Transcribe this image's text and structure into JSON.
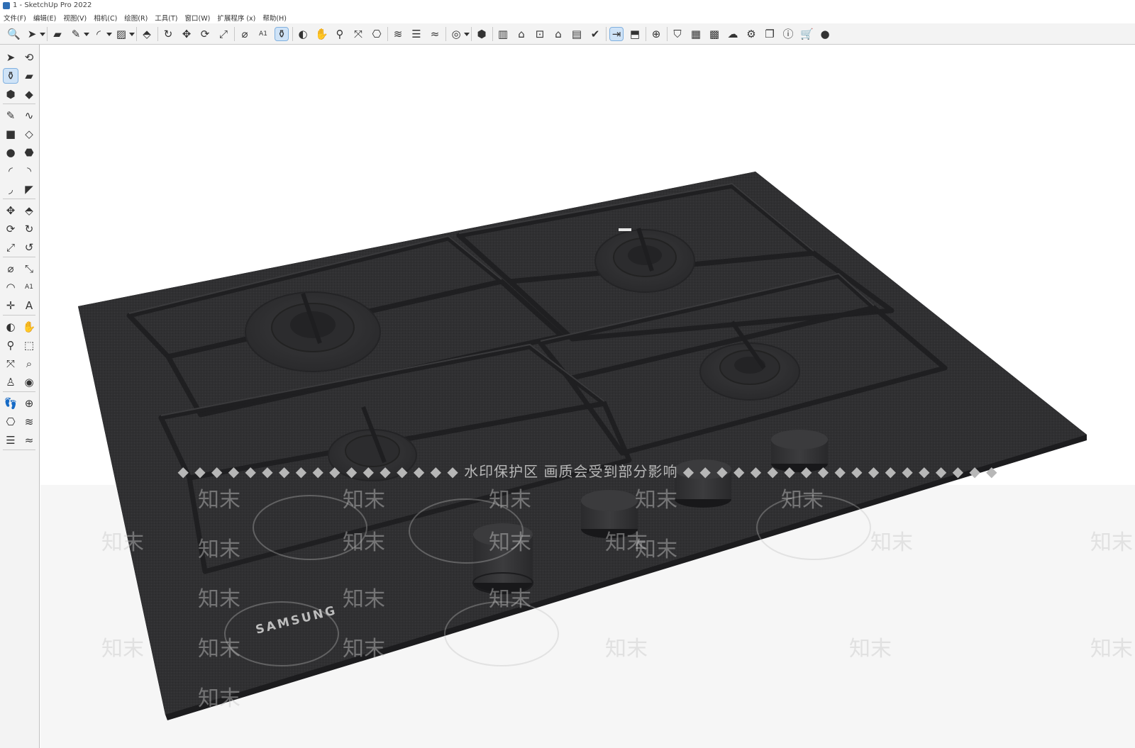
{
  "window": {
    "title": "1 - SketchUp Pro 2022"
  },
  "menu": [
    "文件(F)",
    "编辑(E)",
    "视图(V)",
    "相机(C)",
    "绘图(R)",
    "工具(T)",
    "窗口(W)",
    "扩展程序 (x)",
    "帮助(H)"
  ],
  "toolbar_icons": [
    {
      "name": "zoom-icon",
      "glyph": "🔍"
    },
    {
      "name": "select-icon",
      "glyph": "➤",
      "dropdown": true
    },
    {
      "name": "eraser-icon",
      "glyph": "▰"
    },
    {
      "name": "line-icon",
      "glyph": "✎",
      "dropdown": true
    },
    {
      "name": "arc-icon",
      "glyph": "◜",
      "dropdown": true
    },
    {
      "name": "rectangle-icon",
      "glyph": "▨",
      "dropdown": true
    },
    {
      "name": "push-pull-icon",
      "glyph": "⬘"
    },
    {
      "name": "follow-me-icon",
      "glyph": "↻"
    },
    {
      "name": "move-icon",
      "glyph": "✥"
    },
    {
      "name": "rotate-icon",
      "glyph": "⟳"
    },
    {
      "name": "scale-icon",
      "glyph": "⤢"
    },
    {
      "name": "tape-measure-icon",
      "glyph": "⌀"
    },
    {
      "name": "text-icon",
      "glyph": "A1"
    },
    {
      "name": "paint-bucket-icon",
      "glyph": "⚱",
      "active": true
    },
    {
      "name": "orbit-icon",
      "glyph": "◐"
    },
    {
      "name": "pan-icon",
      "glyph": "✋"
    },
    {
      "name": "zoom-tool-icon",
      "glyph": "⚲"
    },
    {
      "name": "zoom-extents-icon",
      "glyph": "⤧"
    },
    {
      "name": "components-icon",
      "glyph": "⎔"
    },
    {
      "name": "sandbox-icon",
      "glyph": "≋"
    },
    {
      "name": "layers-icon",
      "glyph": "☰"
    },
    {
      "name": "terrain-icon",
      "glyph": "≈"
    },
    {
      "name": "account-icon",
      "glyph": "◎",
      "dropdown": true
    },
    {
      "name": "iso-view-icon",
      "glyph": "⬢"
    },
    {
      "name": "top-view-icon",
      "glyph": "▥"
    },
    {
      "name": "front-view-icon",
      "glyph": "⌂"
    },
    {
      "name": "right-view-icon",
      "glyph": "⊡"
    },
    {
      "name": "back-view-icon",
      "glyph": "⌂"
    },
    {
      "name": "left-view-icon",
      "glyph": "▤"
    },
    {
      "name": "warehouse-icon",
      "glyph": "✔"
    },
    {
      "name": "export-icon",
      "glyph": "⇥",
      "active": true
    },
    {
      "name": "extension-icon",
      "glyph": "⬒"
    },
    {
      "name": "add-location-icon",
      "glyph": "⊕"
    },
    {
      "name": "shield-icon",
      "glyph": "⛉"
    },
    {
      "name": "solid-tools-icon",
      "glyph": "▦"
    },
    {
      "name": "checker-icon",
      "glyph": "▩"
    },
    {
      "name": "cloud-upload-icon",
      "glyph": "☁"
    },
    {
      "name": "settings-icon",
      "glyph": "⚙"
    },
    {
      "name": "window-icon",
      "glyph": "❐"
    },
    {
      "name": "info-icon",
      "glyph": "ⓘ"
    },
    {
      "name": "cart-icon",
      "glyph": "🛒"
    },
    {
      "name": "user-icon",
      "glyph": "●"
    }
  ],
  "side_icons": [
    {
      "name": "select-icon",
      "glyph": "➤"
    },
    {
      "name": "lasso-orbit-icon",
      "glyph": "⟲"
    },
    {
      "name": "paint-bucket-icon",
      "glyph": "⚱",
      "active": true
    },
    {
      "name": "eraser-icon",
      "glyph": "▰"
    },
    {
      "name": "make-component-icon",
      "glyph": "⬢"
    },
    {
      "name": "tag-icon",
      "glyph": "◆"
    },
    {
      "name": "pencil-icon",
      "glyph": "✎"
    },
    {
      "name": "freehand-icon",
      "glyph": "∿"
    },
    {
      "name": "rectangle-icon",
      "glyph": "■"
    },
    {
      "name": "rotated-rectangle-icon",
      "glyph": "◇"
    },
    {
      "name": "circle-icon",
      "glyph": "●"
    },
    {
      "name": "polygon-icon",
      "glyph": "⬣"
    },
    {
      "name": "arc-icon",
      "glyph": "◜"
    },
    {
      "name": "two-point-arc-icon",
      "glyph": "◝"
    },
    {
      "name": "three-point-arc-icon",
      "glyph": "◞"
    },
    {
      "name": "pie-icon",
      "glyph": "◤"
    },
    {
      "name": "move-icon",
      "glyph": "✥"
    },
    {
      "name": "push-pull-icon",
      "glyph": "⬘"
    },
    {
      "name": "rotate-icon",
      "glyph": "⟳"
    },
    {
      "name": "follow-me-icon",
      "glyph": "↻"
    },
    {
      "name": "scale-icon",
      "glyph": "⤢"
    },
    {
      "name": "offset-icon",
      "glyph": "↺"
    },
    {
      "name": "tape-measure-icon",
      "glyph": "⌀"
    },
    {
      "name": "dimension-icon",
      "glyph": "⤡"
    },
    {
      "name": "protractor-icon",
      "glyph": "◠"
    },
    {
      "name": "text-icon",
      "glyph": "A1"
    },
    {
      "name": "axes-icon",
      "glyph": "✛"
    },
    {
      "name": "3d-text-icon",
      "glyph": "A"
    },
    {
      "name": "orbit-icon",
      "glyph": "◐"
    },
    {
      "name": "pan-icon",
      "glyph": "✋"
    },
    {
      "name": "zoom-icon",
      "glyph": "⚲"
    },
    {
      "name": "zoom-window-icon",
      "glyph": "⬚"
    },
    {
      "name": "zoom-extents-icon",
      "glyph": "⤧"
    },
    {
      "name": "previous-view-icon",
      "glyph": "⌕"
    },
    {
      "name": "position-camera-icon",
      "glyph": "♙"
    },
    {
      "name": "look-around-icon",
      "glyph": "◉"
    },
    {
      "name": "walk-icon",
      "glyph": "👣"
    },
    {
      "name": "section-plane-icon",
      "glyph": "⊕"
    },
    {
      "name": "components-icon",
      "glyph": "⎔"
    },
    {
      "name": "sandbox-icon",
      "glyph": "≋"
    },
    {
      "name": "layers-icon",
      "glyph": "☰"
    },
    {
      "name": "terrain-icon",
      "glyph": "≈"
    }
  ],
  "viewport": {
    "brand_label": "SAMSUNG",
    "watermark_banner": "◆ ◆ ◆ ◆ ◆ ◆ ◆ ◆ ◆ ◆ ◆ ◆ ◆ ◆ ◆ ◆ ◆ 水印保护区   画质会受到部分影响 ◆ ◆ ◆ ◆ ◆ ◆ ◆ ◆ ◆ ◆ ◆ ◆ ◆ ◆ ◆ ◆ ◆ ◆ ◆",
    "watermark_mark": "知末"
  },
  "colors": {
    "accent": "#cfe3f7",
    "cooktop": "#2f2f31",
    "grate": "#252527"
  }
}
